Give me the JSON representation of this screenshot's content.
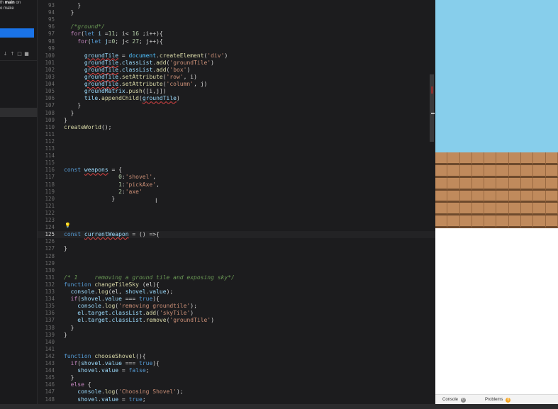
{
  "sidebar": {
    "note_prefix": "th",
    "note_bold": "main",
    "note_suffix": "on",
    "note_line2": "o make",
    "icons": [
      "↓",
      "↑",
      "□",
      "■"
    ]
  },
  "editor": {
    "active_line": 125,
    "lines": [
      {
        "n": "93",
        "segs": [
          [
            "tx",
            "    }"
          ]
        ]
      },
      {
        "n": "94",
        "segs": [
          [
            "tx",
            "  }"
          ]
        ]
      },
      {
        "n": "95",
        "segs": []
      },
      {
        "n": "96",
        "segs": [
          [
            "cm",
            "  /*ground*/"
          ]
        ]
      },
      {
        "n": "97",
        "segs": [
          [
            "kw",
            "  for"
          ],
          [
            "tx",
            "("
          ],
          [
            "kb",
            "let"
          ],
          [
            "vr",
            " i"
          ],
          [
            "tx",
            " ="
          ],
          [
            "nm",
            "11"
          ],
          [
            "tx",
            "; i< "
          ],
          [
            "nm",
            "16"
          ],
          [
            "tx",
            " ;i++){"
          ]
        ]
      },
      {
        "n": "98",
        "segs": [
          [
            "kw",
            "    for"
          ],
          [
            "tx",
            "("
          ],
          [
            "kb",
            "let"
          ],
          [
            "vr",
            " j"
          ],
          [
            "tx",
            "="
          ],
          [
            "nm",
            "0"
          ],
          [
            "tx",
            "; j< "
          ],
          [
            "nm",
            "27"
          ],
          [
            "tx",
            "; j++){"
          ]
        ]
      },
      {
        "n": "99",
        "segs": []
      },
      {
        "n": "100",
        "segs": [
          [
            "tx",
            "      "
          ],
          [
            "vr err",
            "groundTile"
          ],
          [
            "tx",
            " = "
          ],
          [
            "ob",
            "document"
          ],
          [
            "tx",
            "."
          ],
          [
            "fn",
            "createElement"
          ],
          [
            "tx",
            "("
          ],
          [
            "st",
            "'div'"
          ],
          [
            "tx",
            ")"
          ]
        ]
      },
      {
        "n": "101",
        "segs": [
          [
            "tx",
            "      "
          ],
          [
            "vr err",
            "groundTile"
          ],
          [
            "tx",
            "."
          ],
          [
            "vr",
            "classList"
          ],
          [
            "tx",
            "."
          ],
          [
            "fn",
            "add"
          ],
          [
            "tx",
            "("
          ],
          [
            "st",
            "'groundTile'"
          ],
          [
            "tx",
            ")"
          ]
        ]
      },
      {
        "n": "102",
        "segs": [
          [
            "tx",
            "      "
          ],
          [
            "vr err",
            "groundTile"
          ],
          [
            "tx",
            "."
          ],
          [
            "vr",
            "classList"
          ],
          [
            "tx",
            "."
          ],
          [
            "fn",
            "add"
          ],
          [
            "tx",
            "("
          ],
          [
            "st",
            "'box'"
          ],
          [
            "tx",
            ")"
          ]
        ]
      },
      {
        "n": "103",
        "segs": [
          [
            "tx",
            "      "
          ],
          [
            "vr err",
            "groundTile"
          ],
          [
            "tx",
            "."
          ],
          [
            "fn",
            "setAttribute"
          ],
          [
            "tx",
            "("
          ],
          [
            "st",
            "'row'"
          ],
          [
            "tx",
            ", i)"
          ]
        ]
      },
      {
        "n": "104",
        "segs": [
          [
            "tx",
            "      "
          ],
          [
            "vr err",
            "groundTile"
          ],
          [
            "tx",
            "."
          ],
          [
            "fn",
            "setAttribute"
          ],
          [
            "tx",
            "("
          ],
          [
            "st",
            "'column'"
          ],
          [
            "tx",
            ", j)"
          ]
        ]
      },
      {
        "n": "105",
        "segs": [
          [
            "tx",
            "      "
          ],
          [
            "vr",
            "groundMatrix"
          ],
          [
            "tx",
            "."
          ],
          [
            "fn",
            "push"
          ],
          [
            "tx",
            "([i,j])"
          ]
        ]
      },
      {
        "n": "106",
        "segs": [
          [
            "tx",
            "      "
          ],
          [
            "vr",
            "tile"
          ],
          [
            "tx",
            "."
          ],
          [
            "fn",
            "appendChild"
          ],
          [
            "tx",
            "("
          ],
          [
            "vr err",
            "groundTile"
          ],
          [
            "tx",
            ")"
          ]
        ]
      },
      {
        "n": "107",
        "segs": [
          [
            "tx",
            "    }"
          ]
        ]
      },
      {
        "n": "108",
        "segs": [
          [
            "tx",
            "  }"
          ]
        ]
      },
      {
        "n": "109",
        "segs": [
          [
            "tx",
            "}"
          ]
        ]
      },
      {
        "n": "110",
        "segs": [
          [
            "fn",
            "createWorld"
          ],
          [
            "tx",
            "();"
          ]
        ]
      },
      {
        "n": "111",
        "segs": []
      },
      {
        "n": "112",
        "segs": []
      },
      {
        "n": "113",
        "segs": []
      },
      {
        "n": "114",
        "segs": []
      },
      {
        "n": "115",
        "segs": []
      },
      {
        "n": "116",
        "segs": [
          [
            "kb",
            "const"
          ],
          [
            "tx",
            " "
          ],
          [
            "vr err",
            "weapons"
          ],
          [
            "tx",
            " = {"
          ]
        ]
      },
      {
        "n": "117",
        "segs": [
          [
            "tx",
            "                "
          ],
          [
            "nm",
            "0"
          ],
          [
            "tx",
            ":"
          ],
          [
            "st",
            "'shovel'"
          ],
          [
            "tx",
            ","
          ]
        ]
      },
      {
        "n": "118",
        "segs": [
          [
            "tx",
            "                "
          ],
          [
            "nm",
            "1"
          ],
          [
            "tx",
            ":"
          ],
          [
            "st",
            "'pickAxe'"
          ],
          [
            "tx",
            ","
          ]
        ]
      },
      {
        "n": "119",
        "segs": [
          [
            "tx",
            "                "
          ],
          [
            "nm",
            "2"
          ],
          [
            "tx",
            ":"
          ],
          [
            "st",
            "'axe'"
          ]
        ]
      },
      {
        "n": "120",
        "segs": [
          [
            "tx",
            "              }"
          ]
        ]
      },
      {
        "n": "121",
        "segs": []
      },
      {
        "n": "122",
        "segs": []
      },
      {
        "n": "123",
        "segs": []
      },
      {
        "n": "124",
        "segs": []
      },
      {
        "n": "125",
        "segs": [
          [
            "kb",
            "const"
          ],
          [
            "tx",
            " "
          ],
          [
            "vr err",
            "currentWeapon"
          ],
          [
            "tx",
            " = ("
          ],
          [
            "tx",
            ")"
          ],
          [
            "tx",
            " =>{"
          ]
        ]
      },
      {
        "n": "126",
        "segs": []
      },
      {
        "n": "127",
        "segs": [
          [
            "tx",
            "}"
          ]
        ]
      },
      {
        "n": "128",
        "segs": []
      },
      {
        "n": "129",
        "segs": []
      },
      {
        "n": "130",
        "segs": []
      },
      {
        "n": "131",
        "segs": [
          [
            "cm",
            "/* 1     removing a ground tile and exposing sky*/"
          ]
        ]
      },
      {
        "n": "132",
        "segs": [
          [
            "kb",
            "function"
          ],
          [
            "tx",
            " "
          ],
          [
            "fn",
            "changeTileSky"
          ],
          [
            "tx",
            " (el){"
          ]
        ]
      },
      {
        "n": "133",
        "segs": [
          [
            "tx",
            "  "
          ],
          [
            "vr",
            "console"
          ],
          [
            "tx",
            "."
          ],
          [
            "fn",
            "log"
          ],
          [
            "tx",
            "(el, "
          ],
          [
            "vr",
            "shovel"
          ],
          [
            "tx",
            "."
          ],
          [
            "vr",
            "value"
          ],
          [
            "tx",
            ");"
          ]
        ]
      },
      {
        "n": "134",
        "segs": [
          [
            "kw",
            "  if"
          ],
          [
            "tx",
            "("
          ],
          [
            "vr",
            "shovel"
          ],
          [
            "tx",
            "."
          ],
          [
            "vr",
            "value"
          ],
          [
            "tx",
            " === "
          ],
          [
            "kb",
            "true"
          ],
          [
            "tx",
            "){"
          ]
        ]
      },
      {
        "n": "135",
        "segs": [
          [
            "tx",
            "    "
          ],
          [
            "vr",
            "console"
          ],
          [
            "tx",
            "."
          ],
          [
            "fn",
            "log"
          ],
          [
            "tx",
            "("
          ],
          [
            "st",
            "'removing groundtile'"
          ],
          [
            "tx",
            ");"
          ]
        ]
      },
      {
        "n": "136",
        "segs": [
          [
            "tx",
            "    "
          ],
          [
            "vr",
            "el"
          ],
          [
            "tx",
            "."
          ],
          [
            "vr",
            "target"
          ],
          [
            "tx",
            "."
          ],
          [
            "vr",
            "classList"
          ],
          [
            "tx",
            "."
          ],
          [
            "fn",
            "add"
          ],
          [
            "tx",
            "("
          ],
          [
            "st",
            "'skyTile'"
          ],
          [
            "tx",
            ")"
          ]
        ]
      },
      {
        "n": "137",
        "segs": [
          [
            "tx",
            "    "
          ],
          [
            "vr",
            "el"
          ],
          [
            "tx",
            "."
          ],
          [
            "vr",
            "target"
          ],
          [
            "tx",
            "."
          ],
          [
            "vr",
            "classList"
          ],
          [
            "tx",
            "."
          ],
          [
            "fn",
            "remove"
          ],
          [
            "tx",
            "("
          ],
          [
            "st",
            "'groundTile'"
          ],
          [
            "tx",
            ")"
          ]
        ]
      },
      {
        "n": "138",
        "segs": [
          [
            "tx",
            "  }"
          ]
        ]
      },
      {
        "n": "139",
        "segs": [
          [
            "tx",
            "}"
          ]
        ]
      },
      {
        "n": "140",
        "segs": []
      },
      {
        "n": "141",
        "segs": []
      },
      {
        "n": "142",
        "segs": [
          [
            "kb",
            "function"
          ],
          [
            "tx",
            " "
          ],
          [
            "fn",
            "chooseShovel"
          ],
          [
            "tx",
            "(){"
          ]
        ]
      },
      {
        "n": "143",
        "segs": [
          [
            "kw",
            "  if"
          ],
          [
            "tx",
            "("
          ],
          [
            "vr",
            "shovel"
          ],
          [
            "tx",
            "."
          ],
          [
            "vr",
            "value"
          ],
          [
            "tx",
            " === "
          ],
          [
            "kb",
            "true"
          ],
          [
            "tx",
            "){"
          ]
        ]
      },
      {
        "n": "144",
        "segs": [
          [
            "tx",
            "    "
          ],
          [
            "vr",
            "shovel"
          ],
          [
            "tx",
            "."
          ],
          [
            "vr",
            "value"
          ],
          [
            "tx",
            " = "
          ],
          [
            "kb",
            "false"
          ],
          [
            "tx",
            ";"
          ]
        ]
      },
      {
        "n": "145",
        "segs": [
          [
            "tx",
            "  }"
          ]
        ]
      },
      {
        "n": "146",
        "segs": [
          [
            "kw",
            "  else"
          ],
          [
            "tx",
            " {"
          ]
        ]
      },
      {
        "n": "147",
        "segs": [
          [
            "tx",
            "    "
          ],
          [
            "vr",
            "console"
          ],
          [
            "tx",
            "."
          ],
          [
            "fn",
            "log"
          ],
          [
            "tx",
            "("
          ],
          [
            "st",
            "'Choosing Shovel'"
          ],
          [
            "tx",
            ");"
          ]
        ]
      },
      {
        "n": "148",
        "segs": [
          [
            "tx",
            "    "
          ],
          [
            "vr",
            "shovel"
          ],
          [
            "tx",
            "."
          ],
          [
            "vr",
            "value"
          ],
          [
            "tx",
            " = "
          ],
          [
            "kb",
            "true"
          ],
          [
            "tx",
            ";"
          ]
        ]
      },
      {
        "n": "149",
        "segs": [
          [
            "tx",
            "  }"
          ]
        ]
      }
    ]
  },
  "preview": {
    "sky_color": "#87ceeb",
    "ground_color": "#c08a5c",
    "ground_rows": 6,
    "ground_cols": 10
  },
  "statusbar": {
    "console_label": "Console",
    "console_count": "0",
    "problems_label": "Problems",
    "problems_count": "0"
  }
}
